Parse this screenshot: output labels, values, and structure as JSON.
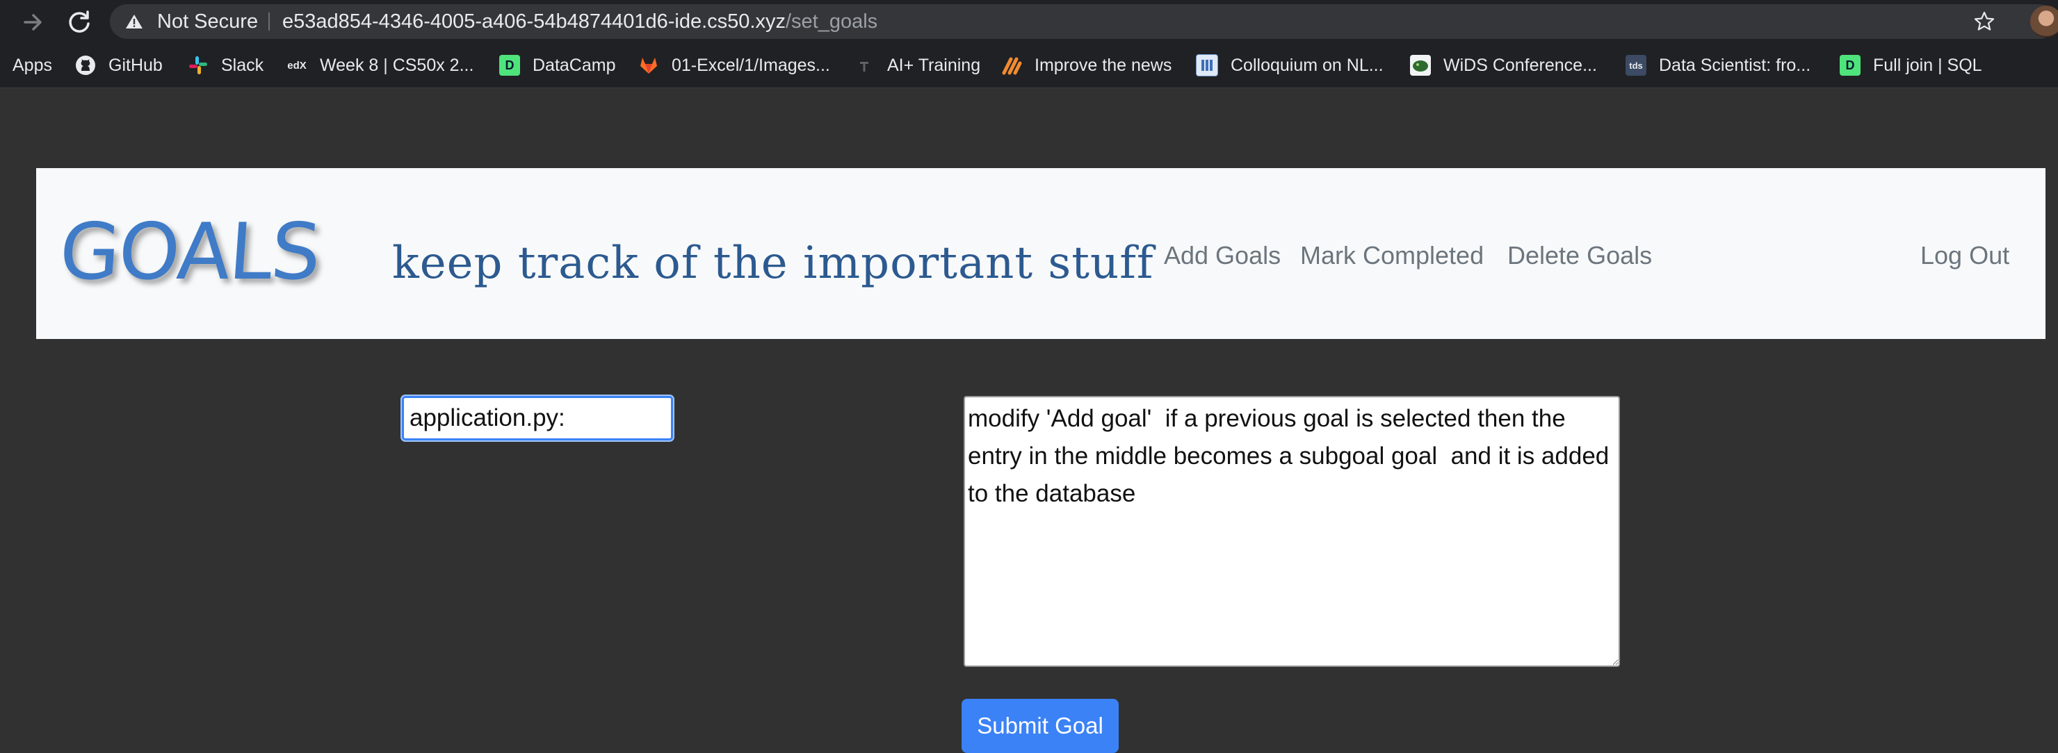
{
  "browser": {
    "security_label": "Not Secure",
    "url_host": "e53ad854-4346-4005-a406-54b4874401d6-ide.cs50.xyz",
    "url_path": "/set_goals",
    "bookmarks": [
      {
        "label": "Apps",
        "icon": "apps-icon"
      },
      {
        "label": "GitHub",
        "icon": "github-icon"
      },
      {
        "label": "Slack",
        "icon": "slack-icon"
      },
      {
        "label": "Week 8 | CS50x 2...",
        "icon": "edx-icon"
      },
      {
        "label": "DataCamp",
        "icon": "datacamp-icon"
      },
      {
        "label": "01-Excel/1/Images...",
        "icon": "gitlab-icon"
      },
      {
        "label": "AI+ Training",
        "icon": "ai-training-icon"
      },
      {
        "label": "Improve the news",
        "icon": "improve-news-icon"
      },
      {
        "label": "Colloquium on NL...",
        "icon": "colloquium-icon"
      },
      {
        "label": "WiDS Conference...",
        "icon": "wids-icon"
      },
      {
        "label": "Data Scientist: fro...",
        "icon": "tds-icon"
      },
      {
        "label": "Full join | SQL",
        "icon": "datacamp-icon"
      }
    ]
  },
  "header": {
    "brand": "GOALS",
    "tagline": "keep track of the important stuff",
    "nav": {
      "add_goals": "Add Goals",
      "mark_completed": "Mark Completed",
      "delete_goals": "Delete Goals",
      "log_out": "Log Out"
    }
  },
  "form": {
    "goal_title_value": "application.py:",
    "goal_description_value": "modify 'Add goal'  if a previous goal is selected then the entry in the middle becomes a subgoal goal  and it is added to the database",
    "submit_label": "Submit Goal"
  },
  "colors": {
    "brand": "#3f7bc7",
    "tagline": "#2c5a90",
    "header_bg": "#f8f9fa",
    "page_bg": "#313131",
    "button": "#3b82f6"
  }
}
